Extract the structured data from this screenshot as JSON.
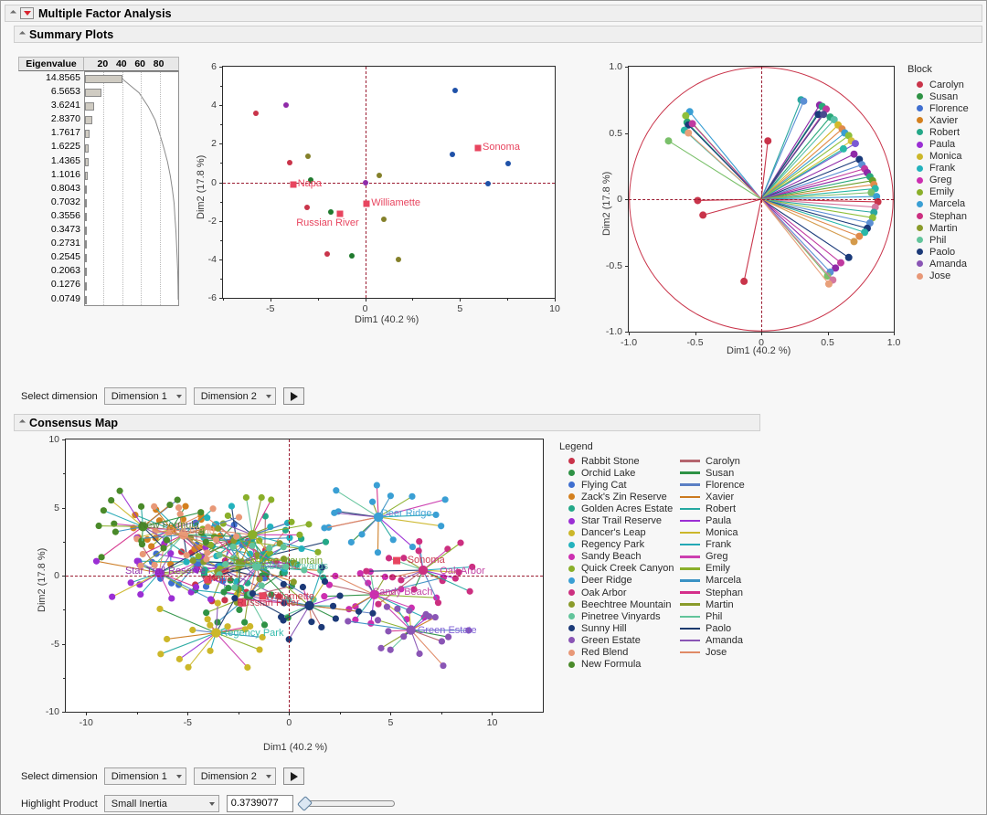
{
  "window": {
    "title": "Multiple Factor Analysis"
  },
  "sections": {
    "summary_plots": "Summary Plots",
    "consensus_map": "Consensus Map"
  },
  "eigen": {
    "header_label": "Eigenvalue",
    "scale_ticks": [
      "20",
      "40",
      "60",
      "80"
    ],
    "values": [
      "14.8565",
      "6.5653",
      "3.6241",
      "2.8370",
      "1.7617",
      "1.6225",
      "1.4365",
      "1.1016",
      "0.8043",
      "0.7032",
      "0.3556",
      "0.3473",
      "0.2731",
      "0.2545",
      "0.2063",
      "0.1276",
      "0.0749"
    ],
    "percent_cumulative": [
      40.2,
      58.0,
      67.8,
      75.5,
      80.2,
      84.6,
      88.5,
      91.5,
      93.7,
      95.6,
      96.5,
      97.5,
      98.2,
      98.9,
      99.5,
      99.8,
      100.0
    ]
  },
  "chart_data": [
    {
      "type": "scatter",
      "name": "individuals-plot",
      "xlabel": "Dim1  (40.2 %)",
      "ylabel": "Dim2  (17.8 %)",
      "xlim": [
        -7.5,
        10
      ],
      "ylim": [
        -6,
        6
      ],
      "xticks": [
        -5,
        0,
        5,
        10
      ],
      "yticks": [
        -6,
        -4,
        -2,
        0,
        2,
        4,
        6
      ],
      "points": [
        {
          "x": -5.75,
          "y": 3.58,
          "color": "#c9344a"
        },
        {
          "x": -4.15,
          "y": 4.02,
          "color": "#8f2aa8"
        },
        {
          "x": -3.98,
          "y": 1.0,
          "color": "#c9344a"
        },
        {
          "x": -3.02,
          "y": 1.37,
          "color": "#84802a"
        },
        {
          "x": -2.87,
          "y": 0.12,
          "color": "#1f7a2e"
        },
        {
          "x": -3.05,
          "y": -1.3,
          "color": "#c9344a"
        },
        {
          "x": -1.8,
          "y": -1.55,
          "color": "#1f7a2e"
        },
        {
          "x": -2.0,
          "y": -3.73,
          "color": "#c9344a"
        },
        {
          "x": -0.72,
          "y": -3.84,
          "color": "#1f7a2e"
        },
        {
          "x": 0.02,
          "y": 0.0,
          "color": "#8f2aa8"
        },
        {
          "x": 0.72,
          "y": 0.36,
          "color": "#84802a"
        },
        {
          "x": 0.98,
          "y": -1.92,
          "color": "#84802a"
        },
        {
          "x": 1.75,
          "y": -4.0,
          "color": "#84802a"
        },
        {
          "x": 4.75,
          "y": 4.78,
          "color": "#1f51a8"
        },
        {
          "x": 4.62,
          "y": 1.46,
          "color": "#1f51a8"
        },
        {
          "x": 7.55,
          "y": 0.98,
          "color": "#1f51a8"
        },
        {
          "x": 6.48,
          "y": -0.09,
          "color": "#1f51a8"
        }
      ],
      "group_labels": [
        {
          "x": 5.95,
          "y": 1.8,
          "text": "Sonoma"
        },
        {
          "x": -3.8,
          "y": -0.13,
          "text": "Napa"
        },
        {
          "x": 0.08,
          "y": -1.12,
          "text": "Williamette"
        },
        {
          "x": -1.32,
          "y": -1.62,
          "text": "Russian River"
        }
      ]
    },
    {
      "type": "scatter",
      "name": "correlation-circle",
      "xlabel": "Dim1  (40.2 %)",
      "ylabel": "Dim2  (17.8 %)",
      "xlim": [
        -1.0,
        1.0
      ],
      "ylim": [
        -1.0,
        1.0
      ],
      "xticks": [
        -1.0,
        -0.5,
        0,
        0.5,
        1.0
      ],
      "yticks": [
        -1.0,
        -0.5,
        0,
        0.5,
        1.0
      ],
      "unit_circle": true,
      "vectors": [
        {
          "x": 0.3,
          "y": 0.75,
          "color": "#2aa8a0"
        },
        {
          "x": 0.32,
          "y": 0.74,
          "color": "#5b8fd4"
        },
        {
          "x": 0.44,
          "y": 0.71,
          "color": "#8f2aa8"
        },
        {
          "x": 0.46,
          "y": 0.7,
          "color": "#2aa87a"
        },
        {
          "x": 0.49,
          "y": 0.68,
          "color": "#c03aa0"
        },
        {
          "x": 0.43,
          "y": 0.64,
          "color": "#1a3a7a"
        },
        {
          "x": 0.47,
          "y": 0.64,
          "color": "#4a4a8f"
        },
        {
          "x": 0.52,
          "y": 0.62,
          "color": "#2aa87a"
        },
        {
          "x": 0.55,
          "y": 0.6,
          "color": "#5ac0a8"
        },
        {
          "x": 0.58,
          "y": 0.56,
          "color": "#d4b82a"
        },
        {
          "x": 0.61,
          "y": 0.53,
          "color": "#e08a4a"
        },
        {
          "x": 0.63,
          "y": 0.5,
          "color": "#3a9fd4"
        },
        {
          "x": 0.66,
          "y": 0.48,
          "color": "#8fbf3a"
        },
        {
          "x": 0.68,
          "y": 0.44,
          "color": "#d4c03a"
        },
        {
          "x": 0.71,
          "y": 0.42,
          "color": "#7a5ad4"
        },
        {
          "x": 0.62,
          "y": 0.38,
          "color": "#2ab8a8"
        },
        {
          "x": 0.7,
          "y": 0.34,
          "color": "#8f2aa8"
        },
        {
          "x": 0.74,
          "y": 0.3,
          "color": "#1a3a7a"
        },
        {
          "x": 0.76,
          "y": 0.26,
          "color": "#5b8fd4"
        },
        {
          "x": 0.78,
          "y": 0.23,
          "color": "#c03aa0"
        },
        {
          "x": 0.8,
          "y": 0.2,
          "color": "#8f2aa8"
        },
        {
          "x": 0.82,
          "y": 0.17,
          "color": "#2aa87a"
        },
        {
          "x": 0.84,
          "y": 0.14,
          "color": "#6a9f2a"
        },
        {
          "x": 0.85,
          "y": 0.11,
          "color": "#e08a4a"
        },
        {
          "x": 0.86,
          "y": 0.08,
          "color": "#2ab8a8"
        },
        {
          "x": 0.83,
          "y": 0.05,
          "color": "#7ac06a"
        },
        {
          "x": 0.87,
          "y": 0.02,
          "color": "#3a9fd4"
        },
        {
          "x": 0.88,
          "y": -0.02,
          "color": "#c9344a"
        },
        {
          "x": 0.86,
          "y": -0.06,
          "color": "#d4789f"
        },
        {
          "x": 0.85,
          "y": -0.1,
          "color": "#2aa8a0"
        },
        {
          "x": 0.84,
          "y": -0.14,
          "color": "#8fbf3a"
        },
        {
          "x": 0.82,
          "y": -0.18,
          "color": "#5b8fd4"
        },
        {
          "x": 0.8,
          "y": -0.22,
          "color": "#1a3a7a"
        },
        {
          "x": 0.78,
          "y": -0.25,
          "color": "#2ab8a8"
        },
        {
          "x": 0.74,
          "y": -0.28,
          "color": "#e08a4a"
        },
        {
          "x": 0.7,
          "y": -0.32,
          "color": "#d49a4a"
        },
        {
          "x": 0.66,
          "y": -0.44,
          "color": "#1a3a7a"
        },
        {
          "x": 0.6,
          "y": -0.48,
          "color": "#c03aa0"
        },
        {
          "x": 0.56,
          "y": -0.52,
          "color": "#8f2aa8"
        },
        {
          "x": 0.52,
          "y": -0.55,
          "color": "#5b8fd4"
        },
        {
          "x": 0.5,
          "y": -0.58,
          "color": "#7ac06a"
        },
        {
          "x": 0.54,
          "y": -0.61,
          "color": "#d4789f"
        },
        {
          "x": 0.51,
          "y": -0.64,
          "color": "#e8a07a"
        },
        {
          "x": -0.54,
          "y": 0.66,
          "color": "#3a9fd4"
        },
        {
          "x": -0.57,
          "y": 0.63,
          "color": "#8fbf3a"
        },
        {
          "x": -0.56,
          "y": 0.58,
          "color": "#2aa87a"
        },
        {
          "x": -0.55,
          "y": 0.56,
          "color": "#1a3a7a"
        },
        {
          "x": -0.52,
          "y": 0.57,
          "color": "#c03aa0"
        },
        {
          "x": -0.58,
          "y": 0.52,
          "color": "#2ab8a8"
        },
        {
          "x": -0.55,
          "y": 0.5,
          "color": "#e8a07a"
        },
        {
          "x": -0.7,
          "y": 0.44,
          "color": "#7ac06a"
        },
        {
          "x": 0.05,
          "y": 0.44,
          "color": "#c9344a"
        },
        {
          "x": -0.48,
          "y": -0.01,
          "color": "#c9344a"
        },
        {
          "x": -0.44,
          "y": -0.12,
          "color": "#c9344a"
        },
        {
          "x": -0.13,
          "y": -0.62,
          "color": "#c9344a"
        }
      ]
    },
    {
      "type": "scatter",
      "name": "consensus-map",
      "xlabel": "Dim1  (40.2 %)",
      "ylabel": "Dim2  (17.8 %)",
      "xlim": [
        -11,
        12.5
      ],
      "ylim": [
        -10,
        10
      ],
      "xticks": [
        -10,
        -5,
        0,
        5,
        10
      ],
      "yticks": [
        -10,
        -5,
        0,
        5,
        10
      ],
      "product_labels": [
        {
          "x": -7.6,
          "y": 3.6,
          "text": "New Formula",
          "color": "#4a7a2a"
        },
        {
          "x": -6.2,
          "y": 3.2,
          "text": "Red Blend",
          "color": "#e8a07a"
        },
        {
          "x": -8.3,
          "y": 0.3,
          "text": "Star Trail Reserve",
          "color": "#8f2aa8"
        },
        {
          "x": -3.0,
          "y": 1.0,
          "text": "Beechtree Mountain",
          "color": "#6a9f2a"
        },
        {
          "x": -2.2,
          "y": 0.6,
          "text": "Pinetree Vinyards",
          "color": "#5ac0a8"
        },
        {
          "x": -1.4,
          "y": -1.6,
          "text": "Williamette",
          "color": "#c9344a"
        },
        {
          "x": -4.2,
          "y": -0.3,
          "text": "Napa",
          "color": "#c9344a"
        },
        {
          "x": -2.8,
          "y": -2.1,
          "text": "Russian River",
          "color": "#c9344a"
        },
        {
          "x": -3.6,
          "y": -4.3,
          "text": "Regency Park",
          "color": "#2ab8a8"
        },
        {
          "x": 4.3,
          "y": 4.5,
          "text": "Deer Ridge",
          "color": "#3a9fd4"
        },
        {
          "x": 5.6,
          "y": 1.1,
          "text": "Sonoma",
          "color": "#c9344a"
        },
        {
          "x": 7.2,
          "y": 0.3,
          "text": "Oak Arbor",
          "color": "#c03aa0"
        },
        {
          "x": 3.9,
          "y": -1.3,
          "text": "Sandy Beach",
          "color": "#c03aa0"
        },
        {
          "x": 6.1,
          "y": -4.1,
          "text": "Green Estate",
          "color": "#7a5ad4"
        }
      ]
    }
  ],
  "block_legend": {
    "title": "Block",
    "items": [
      {
        "label": "Carolyn",
        "color": "#c9344a"
      },
      {
        "label": "Susan",
        "color": "#2e9245"
      },
      {
        "label": "Florence",
        "color": "#3f6fd0"
      },
      {
        "label": "Xavier",
        "color": "#d4801f"
      },
      {
        "label": "Robert",
        "color": "#24a888"
      },
      {
        "label": "Paula",
        "color": "#9b2fd4"
      },
      {
        "label": "Monica",
        "color": "#ccb72a"
      },
      {
        "label": "Frank",
        "color": "#23b2bd"
      },
      {
        "label": "Greg",
        "color": "#cc2fb0"
      },
      {
        "label": "Emily",
        "color": "#8aaf2a"
      },
      {
        "label": "Marcela",
        "color": "#3a9fd4"
      },
      {
        "label": "Stephan",
        "color": "#cc2f80"
      },
      {
        "label": "Martin",
        "color": "#8a9b2a"
      },
      {
        "label": "Phil",
        "color": "#62c49b"
      },
      {
        "label": "Paolo",
        "color": "#1c3a78"
      },
      {
        "label": "Amanda",
        "color": "#8a55b5"
      },
      {
        "label": "Jose",
        "color": "#e89877"
      }
    ]
  },
  "consensus_legend": {
    "title": "Legend",
    "products": [
      {
        "label": "Rabbit Stone",
        "color": "#c9344a"
      },
      {
        "label": "Orchid Lake",
        "color": "#2e9245"
      },
      {
        "label": "Flying Cat",
        "color": "#3f6fd0"
      },
      {
        "label": "Zack's Zin Reserve",
        "color": "#d4801f"
      },
      {
        "label": "Golden Acres Estate",
        "color": "#24a888"
      },
      {
        "label": "Star Trail Reserve",
        "color": "#9b2fd4"
      },
      {
        "label": "Dancer's Leap",
        "color": "#ccb72a"
      },
      {
        "label": "Regency Park",
        "color": "#23b2bd"
      },
      {
        "label": "Sandy Beach",
        "color": "#cc2fb0"
      },
      {
        "label": "Quick Creek Canyon",
        "color": "#8aaf2a"
      },
      {
        "label": "Deer Ridge",
        "color": "#3a9fd4"
      },
      {
        "label": "Oak Arbor",
        "color": "#cc2f80"
      },
      {
        "label": "Beechtree Mountain",
        "color": "#8a9b2a"
      },
      {
        "label": "Pinetree Vinyards",
        "color": "#62c49b"
      },
      {
        "label": "Sunny Hill",
        "color": "#1c3a78"
      },
      {
        "label": "Green Estate",
        "color": "#8a55b5"
      },
      {
        "label": "Red Blend",
        "color": "#e89877"
      },
      {
        "label": "New Formula",
        "color": "#4a8a2a"
      }
    ],
    "blocks": [
      {
        "label": "Carolyn",
        "color": "#b5656e"
      },
      {
        "label": "Susan",
        "color": "#2e9245"
      },
      {
        "label": "Florence",
        "color": "#5b7fc4"
      },
      {
        "label": "Xavier",
        "color": "#cc7a1f"
      },
      {
        "label": "Robert",
        "color": "#24a8a0"
      },
      {
        "label": "Paula",
        "color": "#9b2fd4"
      },
      {
        "label": "Monica",
        "color": "#ccb72a"
      },
      {
        "label": "Frank",
        "color": "#23a8b5"
      },
      {
        "label": "Greg",
        "color": "#cc3fb0"
      },
      {
        "label": "Emily",
        "color": "#8aaf2a"
      },
      {
        "label": "Marcela",
        "color": "#3a92c4"
      },
      {
        "label": "Stephan",
        "color": "#d42f8a"
      },
      {
        "label": "Martin",
        "color": "#8a9b2a"
      },
      {
        "label": "Phil",
        "color": "#62c49b"
      },
      {
        "label": "Paolo",
        "color": "#1c3a6e"
      },
      {
        "label": "Amanda",
        "color": "#8a55b5"
      },
      {
        "label": "Jose",
        "color": "#e08a66"
      }
    ]
  },
  "controls": {
    "select_dimension_label": "Select dimension",
    "dimension_1": "Dimension 1",
    "dimension_2": "Dimension 2",
    "highlight_product_label": "Highlight Product",
    "highlight_product_value": "Small Inertia",
    "inertia_value": "0.3739077"
  }
}
